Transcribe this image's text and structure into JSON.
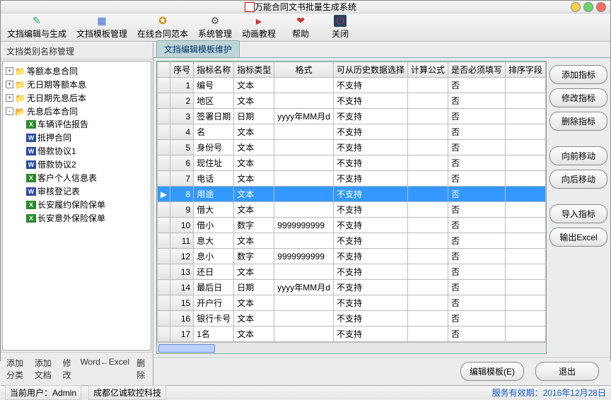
{
  "title": "万能合同文书批量生成系统",
  "toolbar": [
    {
      "label": "文挡编辑与生成",
      "icon": "✎",
      "cls": "ic-edit",
      "name": "tb-edit"
    },
    {
      "label": "文挡模板管理",
      "icon": "▦",
      "cls": "ic-tpl",
      "name": "tb-template"
    },
    {
      "label": "在线合同范本",
      "icon": "✪",
      "cls": "ic-online",
      "name": "tb-online"
    },
    {
      "label": "系统管理",
      "icon": "⚙",
      "cls": "ic-sys",
      "name": "tb-system"
    },
    {
      "label": "动画教程",
      "icon": "►",
      "cls": "ic-anim",
      "name": "tb-tutorial"
    },
    {
      "label": "帮助",
      "icon": "❤",
      "cls": "ic-help",
      "name": "tb-help"
    },
    {
      "label": "关闭",
      "icon": "⏻",
      "cls": "ic-close",
      "name": "tb-close"
    }
  ],
  "left": {
    "title": "文挡类别名称管理",
    "roots": [
      {
        "exp": "+",
        "icon": "folder",
        "label": "等额本息合同"
      },
      {
        "exp": "+",
        "icon": "folder",
        "label": "无日期等额本息"
      },
      {
        "exp": "+",
        "icon": "folder",
        "label": "无日期先息后本"
      },
      {
        "exp": "-",
        "icon": "folder-open",
        "label": "先息后本合同",
        "children": [
          {
            "type": "xg",
            "label": "车辆评估报告"
          },
          {
            "type": "xb",
            "label": "抵押合同"
          },
          {
            "type": "xb",
            "label": "借款协议1"
          },
          {
            "type": "xb",
            "label": "借款协议2"
          },
          {
            "type": "xg",
            "label": "客户个人信息表"
          },
          {
            "type": "xb",
            "label": "审核登记表"
          },
          {
            "type": "xg",
            "label": "长安履约保险保单"
          },
          {
            "type": "xg",
            "label": "长安意外保险保单"
          }
        ]
      }
    ],
    "buttons": [
      "添加分类",
      "添加文档",
      "修改",
      "Word←Excel",
      "删除"
    ]
  },
  "tab": "文挡编辑模板维护",
  "columns": [
    "序号",
    "指标名称",
    "指标类型",
    "格式",
    "可从历史数据选择",
    "计算公式",
    "是否必须填写",
    "排序字段"
  ],
  "rows": [
    {
      "n": 1,
      "name": "编号",
      "type": "文本",
      "fmt": "",
      "hist": "不支持",
      "calc": "",
      "req": "否",
      "sort": ""
    },
    {
      "n": 2,
      "name": "地区",
      "type": "文本",
      "fmt": "",
      "hist": "不支持",
      "calc": "",
      "req": "否",
      "sort": ""
    },
    {
      "n": 3,
      "name": "签署日期",
      "type": "日期",
      "fmt": "yyyy年MM月d",
      "hist": "不支持",
      "calc": "",
      "req": "否",
      "sort": ""
    },
    {
      "n": 4,
      "name": "名",
      "type": "文本",
      "fmt": "",
      "hist": "不支持",
      "calc": "",
      "req": "否",
      "sort": ""
    },
    {
      "n": 5,
      "name": "身份号",
      "type": "文本",
      "fmt": "",
      "hist": "不支持",
      "calc": "",
      "req": "否",
      "sort": ""
    },
    {
      "n": 6,
      "name": "现住址",
      "type": "文本",
      "fmt": "",
      "hist": "不支持",
      "calc": "",
      "req": "否",
      "sort": ""
    },
    {
      "n": 7,
      "name": "电话",
      "type": "文本",
      "fmt": "",
      "hist": "不支持",
      "calc": "",
      "req": "否",
      "sort": ""
    },
    {
      "n": 8,
      "name": "用途",
      "type": "文本",
      "fmt": "",
      "hist": "不支持",
      "calc": "",
      "req": "否",
      "sort": "",
      "sel": true
    },
    {
      "n": 9,
      "name": "借大",
      "type": "文本",
      "fmt": "",
      "hist": "不支持",
      "calc": "",
      "req": "否",
      "sort": ""
    },
    {
      "n": 10,
      "name": "借小",
      "type": "数字",
      "fmt": "9999999999",
      "hist": "不支持",
      "calc": "",
      "req": "否",
      "sort": ""
    },
    {
      "n": 11,
      "name": "息大",
      "type": "文本",
      "fmt": "",
      "hist": "不支持",
      "calc": "",
      "req": "否",
      "sort": ""
    },
    {
      "n": 12,
      "name": "息小",
      "type": "数字",
      "fmt": "9999999999",
      "hist": "不支持",
      "calc": "",
      "req": "否",
      "sort": ""
    },
    {
      "n": 13,
      "name": "还日",
      "type": "文本",
      "fmt": "",
      "hist": "不支持",
      "calc": "",
      "req": "否",
      "sort": ""
    },
    {
      "n": 14,
      "name": "最后日",
      "type": "日期",
      "fmt": "yyyy年MM月d",
      "hist": "不支持",
      "calc": "",
      "req": "否",
      "sort": ""
    },
    {
      "n": 15,
      "name": "开户行",
      "type": "文本",
      "fmt": "",
      "hist": "不支持",
      "calc": "",
      "req": "否",
      "sort": ""
    },
    {
      "n": 16,
      "name": "银行卡号",
      "type": "文本",
      "fmt": "",
      "hist": "不支持",
      "calc": "",
      "req": "否",
      "sort": ""
    },
    {
      "n": 17,
      "name": "1名",
      "type": "文本",
      "fmt": "",
      "hist": "不支持",
      "calc": "",
      "req": "否",
      "sort": ""
    }
  ],
  "sidebuttons": [
    "添加指标",
    "修改指标",
    "删除指标",
    "向前移动",
    "向后移动",
    "导入指标",
    "输出Excel"
  ],
  "bottom": {
    "edit": "编辑模板(E)",
    "exit": "退出"
  },
  "status": {
    "user_label": "当前用户：",
    "user": "Admin",
    "company": "成都亿诚软控科技",
    "service_label": "服务有效期：",
    "service_date": "2016年12月28日"
  }
}
